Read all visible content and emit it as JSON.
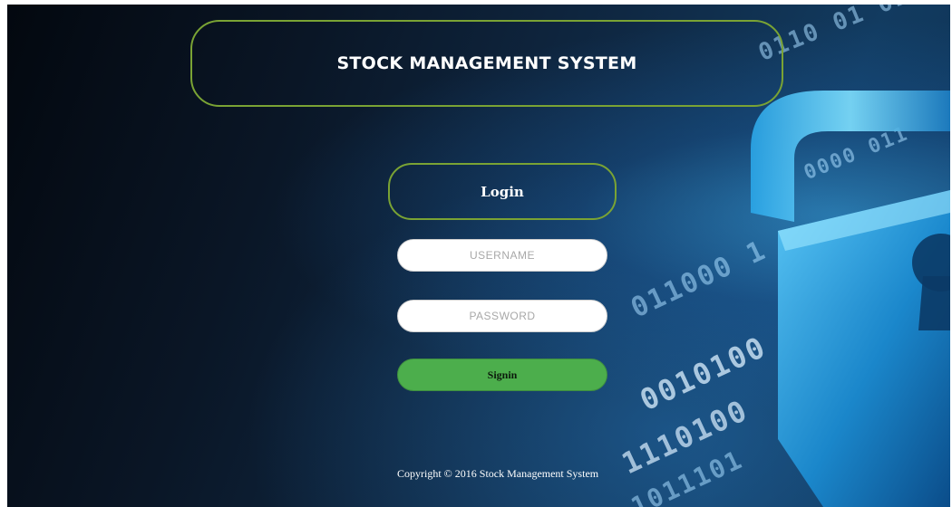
{
  "header": {
    "title": "STOCK MANAGEMENT SYSTEM"
  },
  "login": {
    "heading": "Login",
    "username_placeholder": "USERNAME",
    "password_placeholder": "PASSWORD",
    "signin_label": "Signin"
  },
  "footer": {
    "copyright": "Copyright © 2016 Stock Management System"
  },
  "background": {
    "icon": "padlock-icon",
    "accent_color": "#7aa334",
    "button_color": "#4cae4c"
  }
}
